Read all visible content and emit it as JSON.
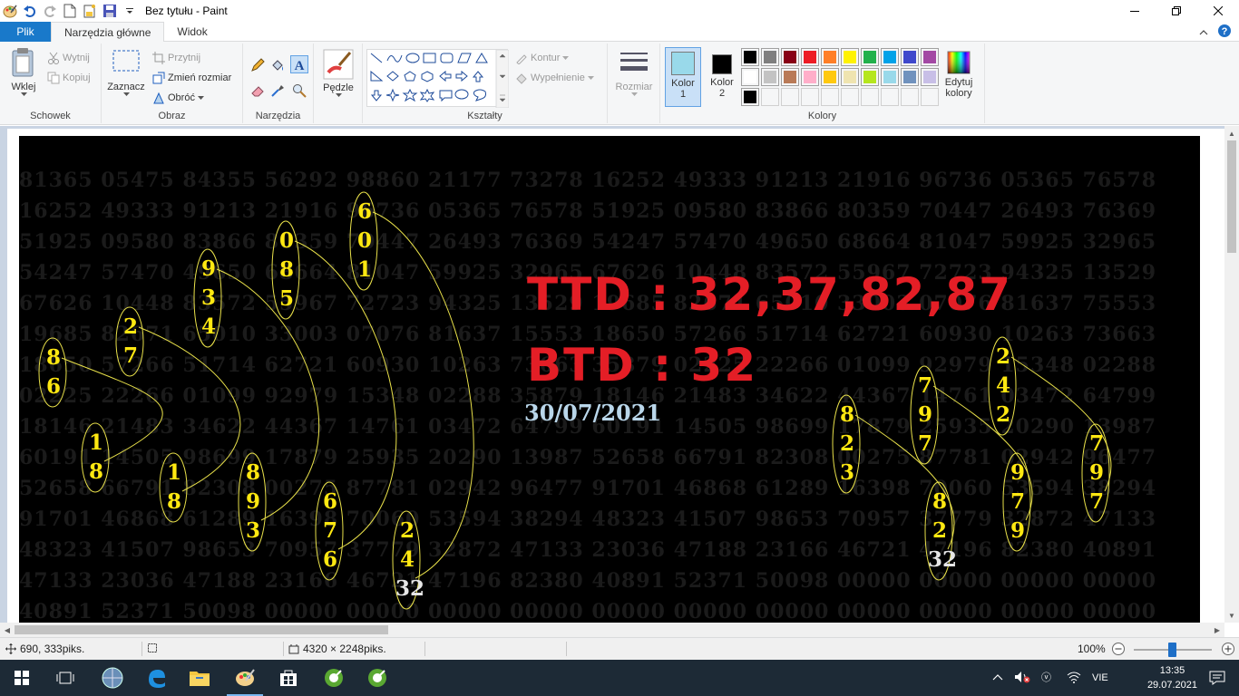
{
  "window": {
    "title": "Bez tytułu - Paint"
  },
  "tabs": [
    {
      "label": "Plik"
    },
    {
      "label": "Narzędzia główne"
    },
    {
      "label": "Widok"
    }
  ],
  "ribbon": {
    "clipboard": {
      "label": "Schowek",
      "paste": "Wklej",
      "cut": "Wytnij",
      "copy": "Kopiuj"
    },
    "image": {
      "label": "Obraz",
      "select": "Zaznacz",
      "crop": "Przytnij",
      "resize": "Zmień rozmiar",
      "rotate": "Obróć"
    },
    "tools": {
      "label": "Narzędzia"
    },
    "brushes": {
      "label": "Pędzle"
    },
    "shapes": {
      "label": "Kształty",
      "outline": "Kontur",
      "fill": "Wypełnienie"
    },
    "size": {
      "label": "Rozmiar"
    },
    "colors": {
      "label": "Kolory",
      "color1": "Kolor 1",
      "color2": "Kolor 2",
      "edit": "Edytuj kolory",
      "color1_value": "#99d9ea",
      "color2_value": "#000000",
      "palette_row1": [
        "#000000",
        "#7f7f7f",
        "#880015",
        "#ed1c24",
        "#ff7f27",
        "#fff200",
        "#22b14c",
        "#00a2e8",
        "#3f48cc",
        "#a349a4"
      ],
      "palette_row2": [
        "#ffffff",
        "#c3c3c3",
        "#b97a57",
        "#ffaec9",
        "#ffc90e",
        "#efe4b0",
        "#b5e61d",
        "#99d9ea",
        "#7092be",
        "#c8bfe7"
      ],
      "palette_row3": [
        "#000000",
        "#ffffff",
        "#ffffff",
        "#ffffff",
        "#ffffff",
        "#ffffff",
        "#ffffff",
        "#ffffff",
        "#ffffff",
        "#ffffff"
      ]
    }
  },
  "image": {
    "background_rows": [
      "81365 05475 84355 56292 98860 21177 73278 16252 49333 91213 21916 96736 05365 76578",
      "16252 49333 91213 21916 96736 05365 76578 51925 09580 83866 80359 70447 26493 76369",
      "51925 09580 83866 80359 70447 26493 76369 54247 57470 49650 68664 81047 59925 32965",
      "54247 57470 49650 68664 81047 59925 32965 67626 10448 83572 55967 72723 94325 13529",
      "67626 10448 83572 55967 72723 94325 13529 19685 82671 65010 33003 07076 81637 75553",
      "19685 82671 65010 33003 07076 81637 15553 18650 57266 51714 62721 60930 10263 73663",
      "18650 57266 51714 62721 60930 10263 73663 35879 02225 22266 01099 92979 15348 02288",
      "02225 22266 01099 92979 15348 02288 35879 18146 21483 34622 44367 14761 03472 64799",
      "18146 21483 34622 44367 14761 03472 64799 60191 14505 98699 17879 25935 20290 13987",
      "60191 14505 98699 17879 25935 20290 13987 52658 66791 82308 00275 87781 02942 96477",
      "52658 66791 82308 00275 87781 02942 96477 91701 46868 61289 16398 70060 53594 38294",
      "91701 46868 61289 16398 70060 53594 38294 48323 41507 98653 70957 37779 32872 47133",
      "48323 41507 98653 70957 37779 32872 47133 23036 47188 23166 46721 47196 82380 40891",
      "47133 23036 47188 23166 46721 47196 82380 40891 52371 50098 00000 00000 00000 00000",
      "40891 52371 50098 00000 00000 00000 00000 00000 00000 00000 00000 00000 00000 00000",
      "00000 00000 00000 00000 00000 00000 00000 00000 00000 00000 00000 00000 00000 00000"
    ],
    "columns": [
      {
        "digits": [
          "8",
          "6"
        ]
      },
      {
        "digits": [
          "1",
          "8"
        ]
      },
      {
        "digits": [
          "2",
          "7"
        ]
      },
      {
        "digits": [
          "1",
          "8"
        ]
      },
      {
        "digits": [
          "9",
          "3",
          "4"
        ]
      },
      {
        "digits": [
          "8",
          "9",
          "3"
        ]
      },
      {
        "digits": [
          "0",
          "8",
          "5"
        ]
      },
      {
        "digits": [
          "6",
          "7",
          "6"
        ]
      },
      {
        "digits": [
          "6",
          "0",
          "1"
        ]
      },
      {
        "digits": [
          "2",
          "4",
          "32"
        ]
      },
      {
        "digits": [
          "8",
          "2",
          "3"
        ]
      },
      {
        "digits": [
          "8",
          "2",
          "32"
        ]
      },
      {
        "digits": [
          "7",
          "9",
          "7"
        ]
      },
      {
        "digits": [
          "9",
          "7",
          "9"
        ]
      },
      {
        "digits": [
          "2",
          "4",
          "2"
        ]
      },
      {
        "digits": [
          "7",
          "9",
          "7"
        ]
      }
    ],
    "ttd": "TTD : 32,37,82,87",
    "btd": "BTD : 32",
    "date": "30/07/2021"
  },
  "status": {
    "cursor": "690, 333piks.",
    "selection": "",
    "size": "4320 × 2248piks.",
    "zoom": "100%"
  },
  "taskbar": {
    "time": "13:35",
    "date": "29.07.2021",
    "lang": "VIE"
  }
}
